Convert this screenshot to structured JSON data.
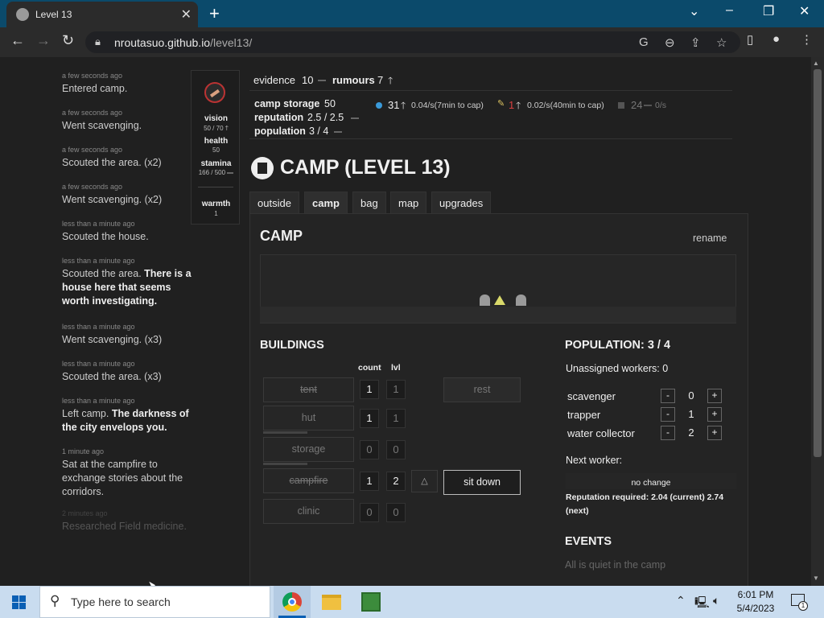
{
  "browser": {
    "tab_title": "Level 13",
    "url_host": "nroutasuo.github.io",
    "url_path": "/level13/"
  },
  "log": [
    {
      "time": "a few seconds ago",
      "text": "Entered camp."
    },
    {
      "time": "a few seconds ago",
      "text": "Went scavenging."
    },
    {
      "time": "a few seconds ago",
      "text": "Scouted the area.",
      "suffix": " (x2)"
    },
    {
      "time": "a few seconds ago",
      "text": "Went scavenging.",
      "suffix": " (x2)"
    },
    {
      "time": "less than a minute ago",
      "text": "Scouted the house."
    },
    {
      "time": "less than a minute ago",
      "text": "Scouted the area.",
      "bold": " There is a house here that seems worth investigating."
    },
    {
      "time": "less than a minute ago",
      "text": "Went scavenging.",
      "suffix": " (x3)"
    },
    {
      "time": "less than a minute ago",
      "text": "Scouted the area.",
      "suffix": " (x3)"
    },
    {
      "time": "less than a minute ago",
      "text": "Left camp.",
      "bold": " The darkness of the city envelops you."
    },
    {
      "time": "1 minute ago",
      "text": "Sat at the campfire to exchange stories about the corridors."
    },
    {
      "time": "2 minutes ago",
      "text": "Researched Field medicine."
    }
  ],
  "stats": {
    "vision_label": "vision",
    "vision_value": "50 / 70",
    "health_label": "health",
    "health_value": "50",
    "stamina_label": "stamina",
    "stamina_value": "166 / 500",
    "warmth_label": "warmth",
    "warmth_value": "1"
  },
  "topbar": {
    "evidence_label": "evidence",
    "evidence_value": "10",
    "rumours_label": "rumours",
    "rumours_value": "7"
  },
  "camp_info": {
    "storage_label": "camp storage",
    "storage_value": "50",
    "reputation_label": "reputation",
    "reputation_value": "2.5 / 2.5",
    "population_label": "population",
    "population_value": "3 / 4"
  },
  "resources": [
    {
      "amount": "31",
      "rate": "0.04/s",
      "cap": "(7min to cap)",
      "color": "#3a9ad9"
    },
    {
      "amount": "1",
      "rate": "0.02/s",
      "cap": "(40min to cap)",
      "color": "#d94040"
    },
    {
      "amount": "24",
      "rate": "0/s",
      "cap": "",
      "color": "#555555"
    }
  ],
  "title": "CAMP (LEVEL 13)",
  "tabs": [
    "outside",
    "camp",
    "bag",
    "map",
    "upgrades"
  ],
  "camp": {
    "heading": "CAMP",
    "rename": "rename"
  },
  "buildings": {
    "heading": "BUILDINGS",
    "count_header": "count",
    "lvl_header": "lvl",
    "rows": [
      {
        "name": "tent",
        "count": "1",
        "lvl": "1",
        "strike": true
      },
      {
        "name": "hut",
        "count": "1",
        "lvl": "1",
        "strike": false
      },
      {
        "name": "storage",
        "count": "0",
        "lvl": "0",
        "strike": false
      },
      {
        "name": "campfire",
        "count": "1",
        "lvl": "2",
        "strike": true
      },
      {
        "name": "clinic",
        "count": "0",
        "lvl": "0",
        "strike": false
      }
    ],
    "rest_label": "rest",
    "sitdown_label": "sit down"
  },
  "population": {
    "heading": "POPULATION: 3 / 4",
    "unassigned": "Unassigned workers: 0",
    "workers": [
      {
        "name": "scavenger",
        "value": "0"
      },
      {
        "name": "trapper",
        "value": "1"
      },
      {
        "name": "water collector",
        "value": "2"
      }
    ],
    "next_worker_label": "Next worker:",
    "next_worker_status": "no change",
    "reputation_req": "Reputation required: 2.04 (current) 2.74 (next)"
  },
  "events": {
    "heading": "EVENTS",
    "text": "All is quiet in the camp"
  },
  "taskbar": {
    "search_placeholder": "Type here to search",
    "time": "6:01 PM",
    "date": "5/4/2023",
    "notif_count": "1"
  }
}
